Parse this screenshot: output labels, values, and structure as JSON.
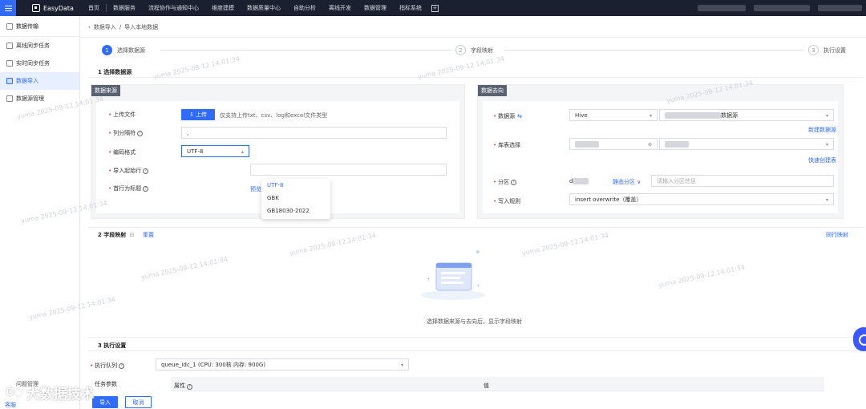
{
  "topbar": {
    "brand": "EasyData",
    "nav": [
      "首页",
      "数据服务",
      "流程协作与通知中心",
      "维度建模",
      "数据质量中心",
      "自助分析",
      "离线开发",
      "数据管理",
      "指标系统"
    ]
  },
  "sidebar": {
    "title": "数据传输",
    "items": [
      {
        "label": "离线同步任务",
        "active": false
      },
      {
        "label": "实时同步任务",
        "active": false
      },
      {
        "label": "数据导入",
        "active": true
      },
      {
        "label": "数据源管理",
        "active": false
      }
    ]
  },
  "breadcrumb": {
    "parent": "数据导入",
    "sep": "/",
    "current": "导入本地数据"
  },
  "steps": [
    {
      "num": "1",
      "label": "选择数据源",
      "active": true
    },
    {
      "num": "2",
      "label": "字段映射",
      "active": false
    },
    {
      "num": "3",
      "label": "执行设置",
      "active": false
    }
  ],
  "section1": {
    "title": "1 选择数据源",
    "source": {
      "head": "数据来源",
      "upload_label": "上传文件",
      "upload_btn": "上传",
      "upload_hint": "仅支持上传txt、csv、log和excel文件类型",
      "delimiter_label": "列分隔符",
      "delimiter_value": ",",
      "encoding_label": "编码格式",
      "encoding_value": "UTF-8",
      "start_row_label": "导入起始行",
      "header_label": "首行为标题",
      "header_link_tail": "预览",
      "encoding_options": [
        "UTF-8",
        "GBK",
        "GB18030-2022"
      ]
    },
    "target": {
      "head": "数据去向",
      "datasource_label": "数据源",
      "datasource_type": "Hive",
      "datasource_tail": "数据源",
      "new_datasource": "新建数据源",
      "table_label": "库表选择",
      "quick_create": "快速创建表",
      "partition_label": "分区",
      "partition_prefix": "d",
      "static_partition": "静态分区",
      "partition_placeholder": "请输入分区信息",
      "write_label": "写入规则",
      "write_value": "insert overwrite（覆盖）"
    }
  },
  "section2": {
    "title": "2 字段映射",
    "reset": "重置",
    "same_row_map": "同行映射",
    "empty_text": "选择数据来源与去向后，显示字段映射"
  },
  "section3": {
    "title": "3 执行设置",
    "queue_label": "执行队列",
    "queue_value": "queue_idc_1 (CPU: 300核 内存: 900G)",
    "task_params_label": "任务参数",
    "col_attr": "属性",
    "col_value": "值"
  },
  "footer": {
    "import_btn": "导入",
    "cancel_btn": "取消",
    "side_bottom_1": "问题管理",
    "side_bottom_2": "客服"
  },
  "watermark": "yuma 2025-09-12 14:01:34",
  "big_watermark": "大数据技术",
  "colors": {
    "primary": "#2f6bff",
    "topbar": "#1b2030",
    "required": "#e34d4d"
  }
}
